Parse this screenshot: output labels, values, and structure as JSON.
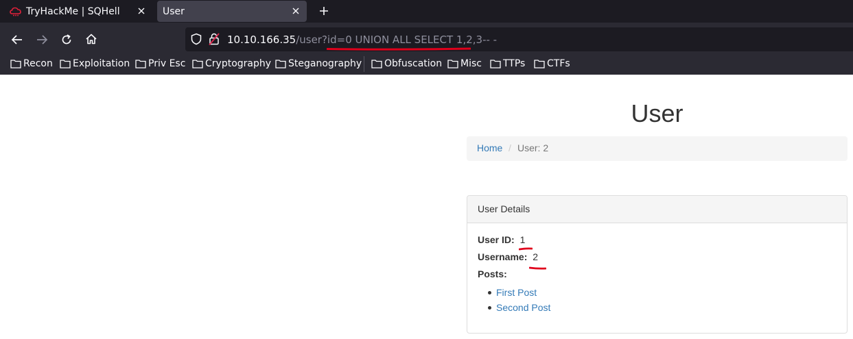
{
  "browser": {
    "tabs": [
      {
        "label": "TryHackMe | SQHell",
        "icon": "tryhackme-icon",
        "active": false
      },
      {
        "label": "User",
        "icon": "none",
        "active": true
      }
    ],
    "url_host": "10.10.166.35",
    "url_path": "/user?id=",
    "url_query": "0 UNION ALL SELECT 1,2,3-- -",
    "bookmarks": [
      "Recon",
      "Exploitation",
      "Priv Esc",
      "Cryptography",
      "Steganography",
      "Obfuscation",
      "Misc",
      "TTPs",
      "CTFs"
    ]
  },
  "page": {
    "title": "User",
    "breadcrumb": {
      "home": "Home",
      "separator": "/",
      "current": "User: 2"
    },
    "panel": {
      "heading": "User Details",
      "user_id_label": "User ID:",
      "user_id_value": "1",
      "username_label": "Username:",
      "username_value": "2",
      "posts_label": "Posts:",
      "posts": [
        "First Post",
        "Second Post"
      ]
    }
  },
  "colors": {
    "chrome_dark": "#1c1b22",
    "chrome_mid": "#2b2a33",
    "link": "#337ab7",
    "annotation_red": "#e0001b"
  }
}
